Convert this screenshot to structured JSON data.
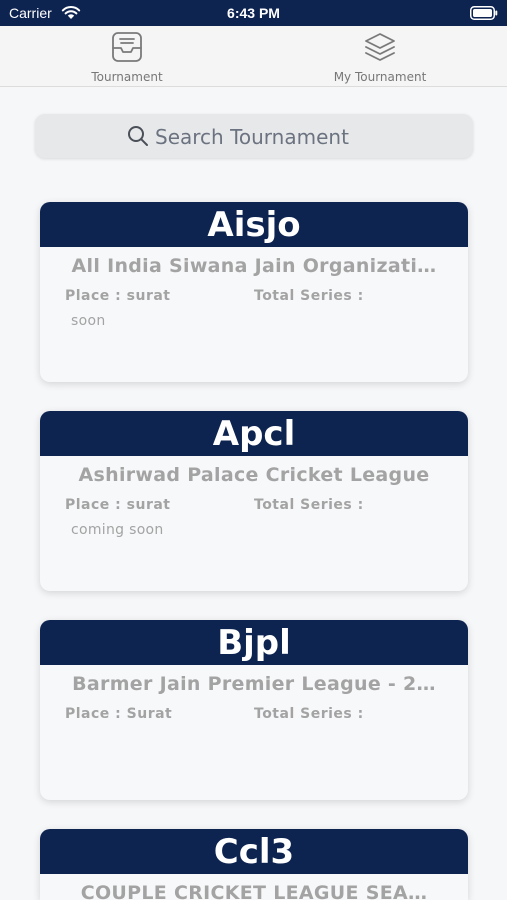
{
  "status_bar": {
    "carrier": "Carrier",
    "time": "6:43 PM"
  },
  "tabs": [
    {
      "label": "Tournament",
      "icon": "inbox-tray-icon"
    },
    {
      "label": "My Tournament",
      "icon": "layers-stack-icon"
    }
  ],
  "search": {
    "placeholder": "Search Tournament"
  },
  "cards": [
    {
      "code": "Aisjo",
      "name": "All India Siwana Jain Organizati…",
      "place": "Place : surat",
      "series": "Total Series :",
      "status": "soon"
    },
    {
      "code": "Apcl",
      "name": "Ashirwad Palace Cricket League",
      "place": "Place : surat",
      "series": "Total Series :",
      "status": "coming soon"
    },
    {
      "code": "Bjpl",
      "name": "Barmer Jain Premier League - 2…",
      "place": "Place : Surat",
      "series": "Total Series :",
      "status": ""
    },
    {
      "code": "Ccl3",
      "name": "COUPLE CRICKET LEAGUE SEA…",
      "place": "",
      "series": "",
      "status": ""
    }
  ],
  "colors": {
    "header_navy": "#0d2350",
    "background": "#f6f7f9",
    "muted_text": "#a3a3a3"
  }
}
